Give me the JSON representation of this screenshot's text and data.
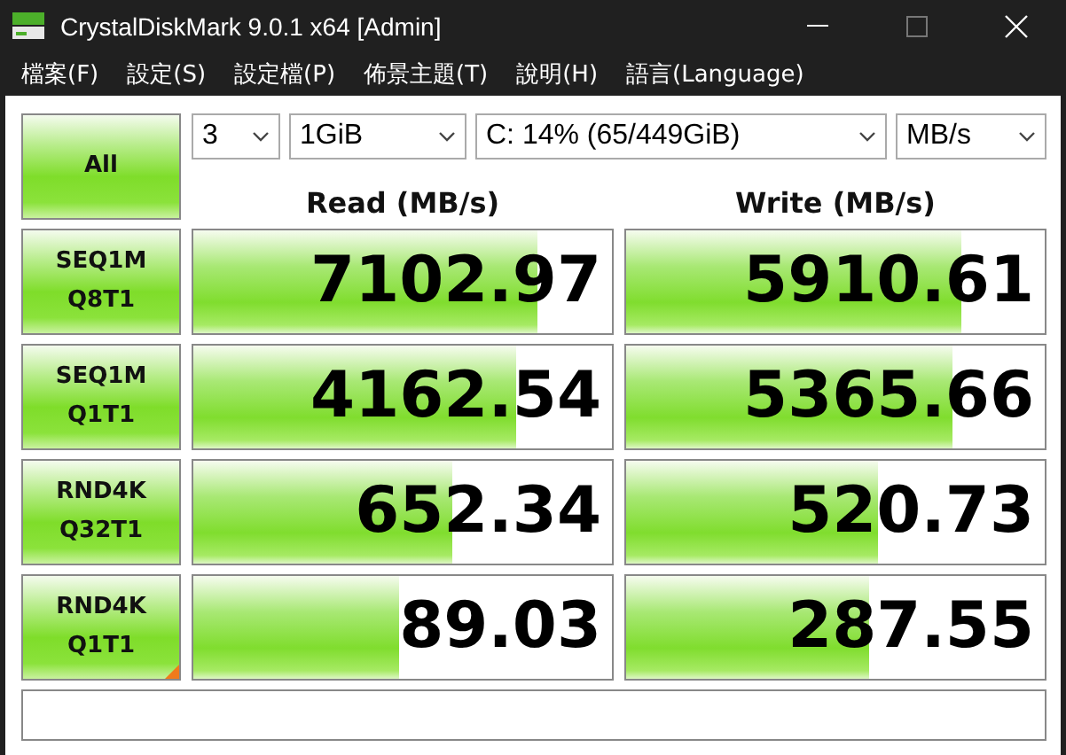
{
  "window": {
    "title": "CrystalDiskMark 9.0.1 x64 [Admin]"
  },
  "menu": [
    "檔案(F)",
    "設定(S)",
    "設定檔(P)",
    "佈景主題(T)",
    "說明(H)",
    "語言(Language)"
  ],
  "all_button": "All",
  "selectors": {
    "count": "3",
    "size": "1GiB",
    "drive": "C: 14% (65/449GiB)",
    "unit": "MB/s"
  },
  "headers": {
    "read": "Read (MB/s)",
    "write": "Write (MB/s)"
  },
  "tests": [
    {
      "line1": "SEQ1M",
      "line2": "Q8T1",
      "read": {
        "value": "7102.97",
        "level": 0.82
      },
      "write": {
        "value": "5910.61",
        "level": 0.8
      }
    },
    {
      "line1": "SEQ1M",
      "line2": "Q1T1",
      "read": {
        "value": "4162.54",
        "level": 0.77
      },
      "write": {
        "value": "5365.66",
        "level": 0.78
      }
    },
    {
      "line1": "RND4K",
      "line2": "Q32T1",
      "read": {
        "value": "652.34",
        "level": 0.62
      },
      "write": {
        "value": "520.73",
        "level": 0.6
      }
    },
    {
      "line1": "RND4K",
      "line2": "Q1T1",
      "read": {
        "value": "89.03",
        "level": 0.49
      },
      "write": {
        "value": "287.55",
        "level": 0.58
      }
    }
  ]
}
